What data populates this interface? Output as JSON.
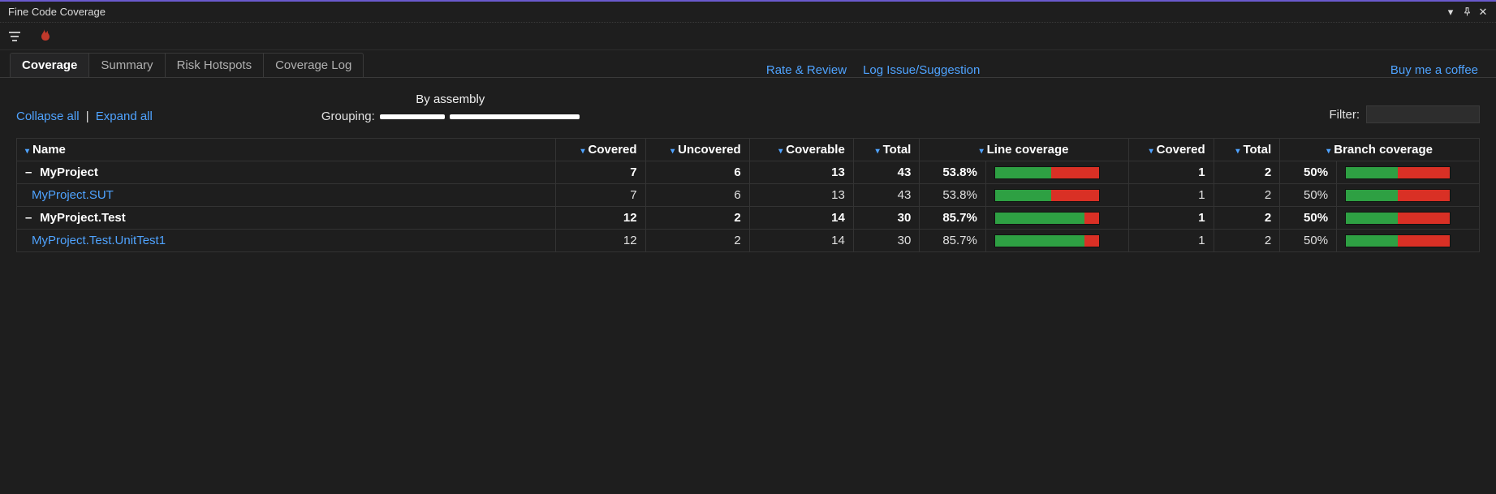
{
  "window": {
    "title": "Fine Code Coverage"
  },
  "tabs": {
    "items": [
      "Coverage",
      "Summary",
      "Risk Hotspots",
      "Coverage Log"
    ],
    "active_index": 0
  },
  "header_links": {
    "rate": "Rate & Review",
    "issue": "Log Issue/Suggestion",
    "coffee": "Buy me a coffee"
  },
  "controls": {
    "collapse_all": "Collapse all",
    "expand_all": "Expand all",
    "grouping_label": "Grouping:",
    "grouping_top": "By assembly",
    "filter_label": "Filter:",
    "filter_value": ""
  },
  "columns": {
    "name": "Name",
    "covered": "Covered",
    "uncovered": "Uncovered",
    "coverable": "Coverable",
    "total": "Total",
    "line_coverage": "Line coverage",
    "b_covered": "Covered",
    "b_total": "Total",
    "branch_coverage": "Branch coverage"
  },
  "rows": [
    {
      "type": "assembly",
      "name": "MyProject",
      "covered": "7",
      "uncovered": "6",
      "coverable": "13",
      "total": "43",
      "line_pct": "53.8%",
      "line_pct_num": 53.8,
      "b_covered": "1",
      "b_total": "2",
      "branch_pct": "50%",
      "branch_pct_num": 50
    },
    {
      "type": "child",
      "name": "MyProject.SUT",
      "covered": "7",
      "uncovered": "6",
      "coverable": "13",
      "total": "43",
      "line_pct": "53.8%",
      "line_pct_num": 53.8,
      "b_covered": "1",
      "b_total": "2",
      "branch_pct": "50%",
      "branch_pct_num": 50
    },
    {
      "type": "assembly",
      "name": "MyProject.Test",
      "covered": "12",
      "uncovered": "2",
      "coverable": "14",
      "total": "30",
      "line_pct": "85.7%",
      "line_pct_num": 85.7,
      "b_covered": "1",
      "b_total": "2",
      "branch_pct": "50%",
      "branch_pct_num": 50
    },
    {
      "type": "child",
      "name": "MyProject.Test.UnitTest1",
      "covered": "12",
      "uncovered": "2",
      "coverable": "14",
      "total": "30",
      "line_pct": "85.7%",
      "line_pct_num": 85.7,
      "b_covered": "1",
      "b_total": "2",
      "branch_pct": "50%",
      "branch_pct_num": 50
    }
  ]
}
